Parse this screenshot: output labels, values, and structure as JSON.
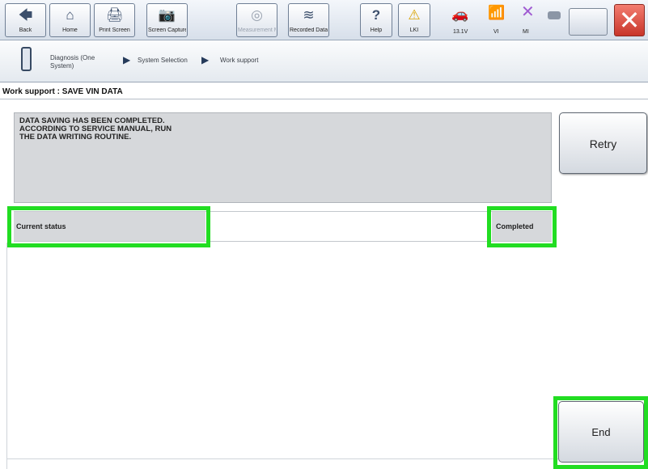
{
  "toolbar": {
    "buttons": [
      {
        "icon": "back-icon",
        "glyph": "🡄",
        "label": "Back"
      },
      {
        "icon": "home-icon",
        "glyph": "⌂",
        "label": "Home"
      },
      {
        "icon": "print-screen-icon",
        "glyph": "🖨",
        "label": "Print Screen"
      },
      {
        "icon": "screen-capture-icon",
        "glyph": "📷",
        "label": "Screen Capture"
      },
      {
        "icon": "measurement-mode-icon",
        "glyph": "◎",
        "label": "Measurement Mode"
      },
      {
        "icon": "recorded-data-icon",
        "glyph": "≋",
        "label": "Recorded Data"
      },
      {
        "icon": "help-icon",
        "glyph": "?",
        "label": "Help"
      },
      {
        "icon": "warning-icon",
        "glyph": "⚠",
        "label": "LKI"
      }
    ],
    "status": [
      {
        "icon": "car-icon",
        "glyph": "🚗",
        "label": "13.1V"
      },
      {
        "icon": "signal-icon",
        "glyph": "📶",
        "label": "VI"
      },
      {
        "icon": "mi-cross-icon",
        "glyph": "✕",
        "label": "MI"
      }
    ],
    "close_glyph": "✕"
  },
  "breadcrumb": {
    "items": [
      "Diagnosis (One System)",
      "System Selection",
      "Work support"
    ]
  },
  "page_title": "Work support : SAVE VIN DATA",
  "message": "DATA SAVING HAS BEEN COMPLETED.\nACCORDING TO SERVICE MANUAL, RUN\nTHE DATA WRITING ROUTINE.",
  "status": {
    "label": "Current status",
    "value": "Completed"
  },
  "buttons": {
    "retry": "Retry",
    "end": "End"
  },
  "colors": {
    "highlight": "#22dd22",
    "panel_gray": "#d6d8db",
    "close_red": "#d2382c"
  }
}
